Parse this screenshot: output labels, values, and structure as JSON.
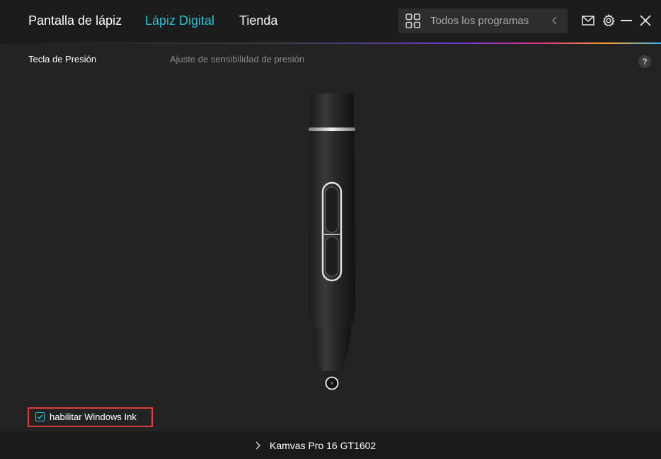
{
  "nav": {
    "tabs": [
      {
        "label": "Pantalla de lápiz"
      },
      {
        "label": "Lápiz Digital"
      },
      {
        "label": "Tienda"
      }
    ],
    "active_tab": "Lápiz Digital",
    "program_selector": {
      "value": "Todos los programas",
      "icon": "grid-icon"
    }
  },
  "window_controls": [
    "mail-icon",
    "gear-icon",
    "minimize-icon",
    "close-icon"
  ],
  "sub_tabs": [
    {
      "label": "Tecla de Presión"
    },
    {
      "label": "Ajuste de sensibilidad de presión"
    }
  ],
  "help": {
    "label": "?"
  },
  "windows_ink": {
    "label": "habilitar Windows Ink",
    "checked": true
  },
  "footer": {
    "device": "Kamvas Pro 16 GT1602"
  },
  "colors": {
    "accent": "#2bc3cf",
    "highlight_border": "#e23b3b",
    "background": "#232323"
  }
}
